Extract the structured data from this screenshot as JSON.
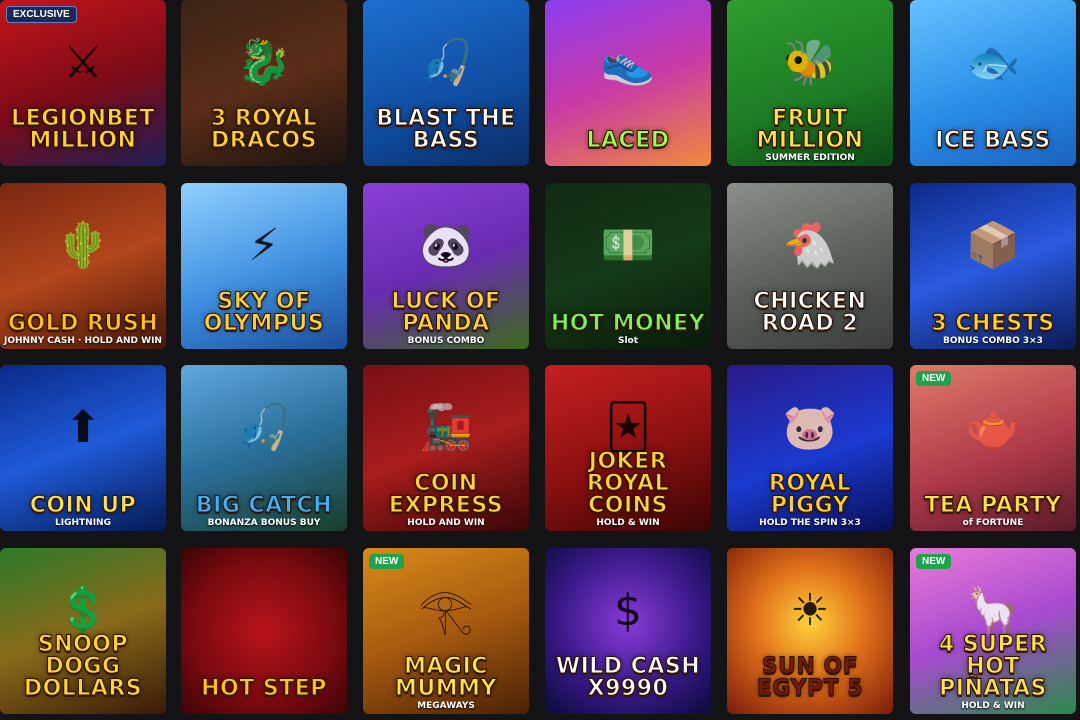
{
  "tiles": [
    {
      "title": "LEGIONBET MILLION",
      "sub": "",
      "badge": "EXCLUSIVE",
      "badgeType": "exclusive",
      "bg": "linear-gradient(160deg,#c4141a 0%,#7a0b18 55%,#1e1e55 100%)",
      "titleColor": "#ffd23a",
      "icon": "spartan-helmet-icon",
      "glyph": "⚔"
    },
    {
      "title": "3 ROYAL DRACOS",
      "sub": "",
      "badge": "",
      "badgeType": "",
      "bg": "linear-gradient(160deg,#3a2414 0%,#5b2d18 50%,#1b140f 100%)",
      "titleColor": "#ffcf33",
      "icon": "dragon-icon",
      "glyph": "🐉"
    },
    {
      "title": "BLAST THE BASS",
      "sub": "",
      "badge": "",
      "badgeType": "",
      "bg": "linear-gradient(160deg,#1c6fd1 0%,#0f4ca0 60%,#0b2c66 100%)",
      "titleColor": "#ffffff",
      "icon": "fisherman-icon",
      "glyph": "🎣"
    },
    {
      "title": "LACED",
      "sub": "",
      "badge": "",
      "badgeType": "",
      "bg": "linear-gradient(160deg,#8b3cf0 0%,#c93aa6 50%,#f08a3a 100%)",
      "titleColor": "#9cff4a",
      "icon": "sneaker-icon",
      "glyph": "👟"
    },
    {
      "title": "FRUIT MILLION",
      "sub": "SUMMER EDITION",
      "badge": "",
      "badgeType": "",
      "bg": "linear-gradient(160deg,#2e9d2e 0%,#1c7a24 60%,#0d4a17 100%)",
      "titleColor": "#ffe14a",
      "icon": "bee-icon",
      "glyph": "🐝"
    },
    {
      "title": "ICE BASS",
      "sub": "",
      "badge": "",
      "badgeType": "",
      "bg": "linear-gradient(160deg,#65c1ff 0%,#2a8ee8 55%,#1a63c2 100%)",
      "titleColor": "#ffffff",
      "icon": "fish-icon",
      "glyph": "🐟"
    },
    {
      "title": "GOLD RUSH",
      "sub": "JOHNNY CASH · HOLD AND WIN",
      "badge": "",
      "badgeType": "",
      "bg": "linear-gradient(160deg,#7a2710 0%,#b2461c 50%,#4a1708 100%)",
      "titleColor": "#ffc21a",
      "icon": "cactus-cowboy-icon",
      "glyph": "🌵"
    },
    {
      "title": "SKY OF OLYMPUS",
      "sub": "",
      "badge": "",
      "badgeType": "",
      "bg": "linear-gradient(160deg,#8fd0ff 0%,#3f8fe0 55%,#1a4e9b 100%)",
      "titleColor": "#ffd23a",
      "icon": "zeus-icon",
      "glyph": "⚡"
    },
    {
      "title": "LUCK OF PANDA",
      "sub": "BONUS COMBO",
      "badge": "",
      "badgeType": "",
      "bg": "linear-gradient(160deg,#8a3fd8 0%,#6a2bb3 50%,#3a6a1a 100%)",
      "titleColor": "#ffd23a",
      "icon": "panda-icon",
      "glyph": "🐼"
    },
    {
      "title": "HOT MONEY",
      "sub": "Slot",
      "badge": "",
      "badgeType": "",
      "bg": "linear-gradient(160deg,#0f2a12 0%,#153a18 50%,#0a1a0b 100%)",
      "titleColor": "#7df05a",
      "icon": "money-stack-icon",
      "glyph": "💵"
    },
    {
      "title": "CHICKEN ROAD 2",
      "sub": "",
      "badge": "",
      "badgeType": "",
      "bg": "linear-gradient(160deg,#8a8f8a 0%,#5c615c 50%,#3a3d3a 100%)",
      "titleColor": "#ffffff",
      "icon": "chicken-icon",
      "glyph": "🐔"
    },
    {
      "title": "3 CHESTS",
      "sub": "BONUS COMBO 3×3",
      "badge": "",
      "badgeType": "",
      "bg": "linear-gradient(160deg,#0d2a8a 0%,#2a5ae0 50%,#0a1a55 100%)",
      "titleColor": "#ffcf33",
      "icon": "treasure-chest-icon",
      "glyph": "📦"
    },
    {
      "title": "COIN UP",
      "sub": "LIGHTNING",
      "badge": "",
      "badgeType": "",
      "bg": "linear-gradient(160deg,#0a2a8a 0%,#1f5ad8 50%,#061a55 100%)",
      "titleColor": "#ffe14a",
      "icon": "coin-up-icon",
      "glyph": "⬆"
    },
    {
      "title": "BIG CATCH",
      "sub": "BONANZA BONUS BUY",
      "badge": "",
      "badgeType": "",
      "bg": "linear-gradient(160deg,#5fa8dd 0%,#2a6f9b 50%,#1a3f2a 100%)",
      "titleColor": "#3fb0ff",
      "icon": "angler-icon",
      "glyph": "🎣"
    },
    {
      "title": "COIN EXPRESS",
      "sub": "HOLD AND WIN",
      "badge": "",
      "badgeType": "",
      "bg": "linear-gradient(160deg,#7a0f14 0%,#a81c1c 50%,#3a0608 100%)",
      "titleColor": "#ffd23a",
      "icon": "train-icon",
      "glyph": "🚂"
    },
    {
      "title": "JOKER ROYAL COINS",
      "sub": "HOLD & WIN",
      "badge": "",
      "badgeType": "",
      "bg": "linear-gradient(160deg,#c61f1f 0%,#8a1010 55%,#3a0505 100%)",
      "titleColor": "#ffd23a",
      "icon": "jester-icon",
      "glyph": "🃏"
    },
    {
      "title": "ROYAL PIGGY",
      "sub": "HOLD THE SPIN 3×3",
      "badge": "",
      "badgeType": "",
      "bg": "linear-gradient(160deg,#2a1a8a 0%,#1a3ad0 55%,#0a0f55 100%)",
      "titleColor": "#ffcf33",
      "icon": "piggy-bank-icon",
      "glyph": "🐷"
    },
    {
      "title": "Tea Party",
      "sub": "of FORTUNE",
      "badge": "NEW",
      "badgeType": "new",
      "bg": "linear-gradient(160deg,#e07a6a 0%,#b03a4a 55%,#5a1a2a 100%)",
      "titleColor": "#ffe14a",
      "icon": "alice-icon",
      "glyph": "🫖"
    },
    {
      "title": "SNOOP DOGG DOLLARS",
      "sub": "",
      "badge": "",
      "badgeType": "",
      "bg": "linear-gradient(160deg,#2a7a2a 0%,#8a6a1a 50%,#3a1a08 100%)",
      "titleColor": "#ffd23a",
      "icon": "rapper-icon",
      "glyph": "💲"
    },
    {
      "title": "HOT STEP",
      "sub": "",
      "badge": "",
      "badgeType": "",
      "bg": "radial-gradient(circle at 50% 50%,#b8141a 0%,#7a0a0f 60%,#3a0407 100%)",
      "titleColor": "#ffc21a",
      "icon": "flame-icon",
      "glyph": ""
    },
    {
      "title": "MAGIC MUMMY",
      "sub": "MEGAWAYS",
      "badge": "NEW",
      "badgeType": "new",
      "bg": "linear-gradient(160deg,#d88a1a 0%,#a85a0f 50%,#4a2206 100%)",
      "titleColor": "#ffe14a",
      "icon": "pharaoh-icon",
      "glyph": "𓂀"
    },
    {
      "title": "Wild CASH X9990",
      "sub": "",
      "badge": "",
      "badgeType": "",
      "bg": "radial-gradient(circle at 50% 45%,#8a3ad8 0%,#3a1a8a 55%,#0a0a3a 100%)",
      "titleColor": "#ffffff",
      "icon": "vinyl-icon",
      "glyph": "$"
    },
    {
      "title": "SUN OF EGYPT 5",
      "sub": "",
      "badge": "",
      "badgeType": "",
      "bg": "radial-gradient(circle at 50% 45%,#ffd23a 0%,#e0701a 45%,#7a1a0a 100%)",
      "titleColor": "#7a1a0a",
      "icon": "sun-icon",
      "glyph": "☀"
    },
    {
      "title": "4 SUPER HOT PIÑATAS",
      "sub": "HOLD & WIN",
      "badge": "NEW",
      "badgeType": "new",
      "bg": "linear-gradient(160deg,#e87ad8 0%,#a84ad0 50%,#2a8a4a 100%)",
      "titleColor": "#ffe14a",
      "icon": "llama-pinata-icon",
      "glyph": "🦙"
    }
  ]
}
